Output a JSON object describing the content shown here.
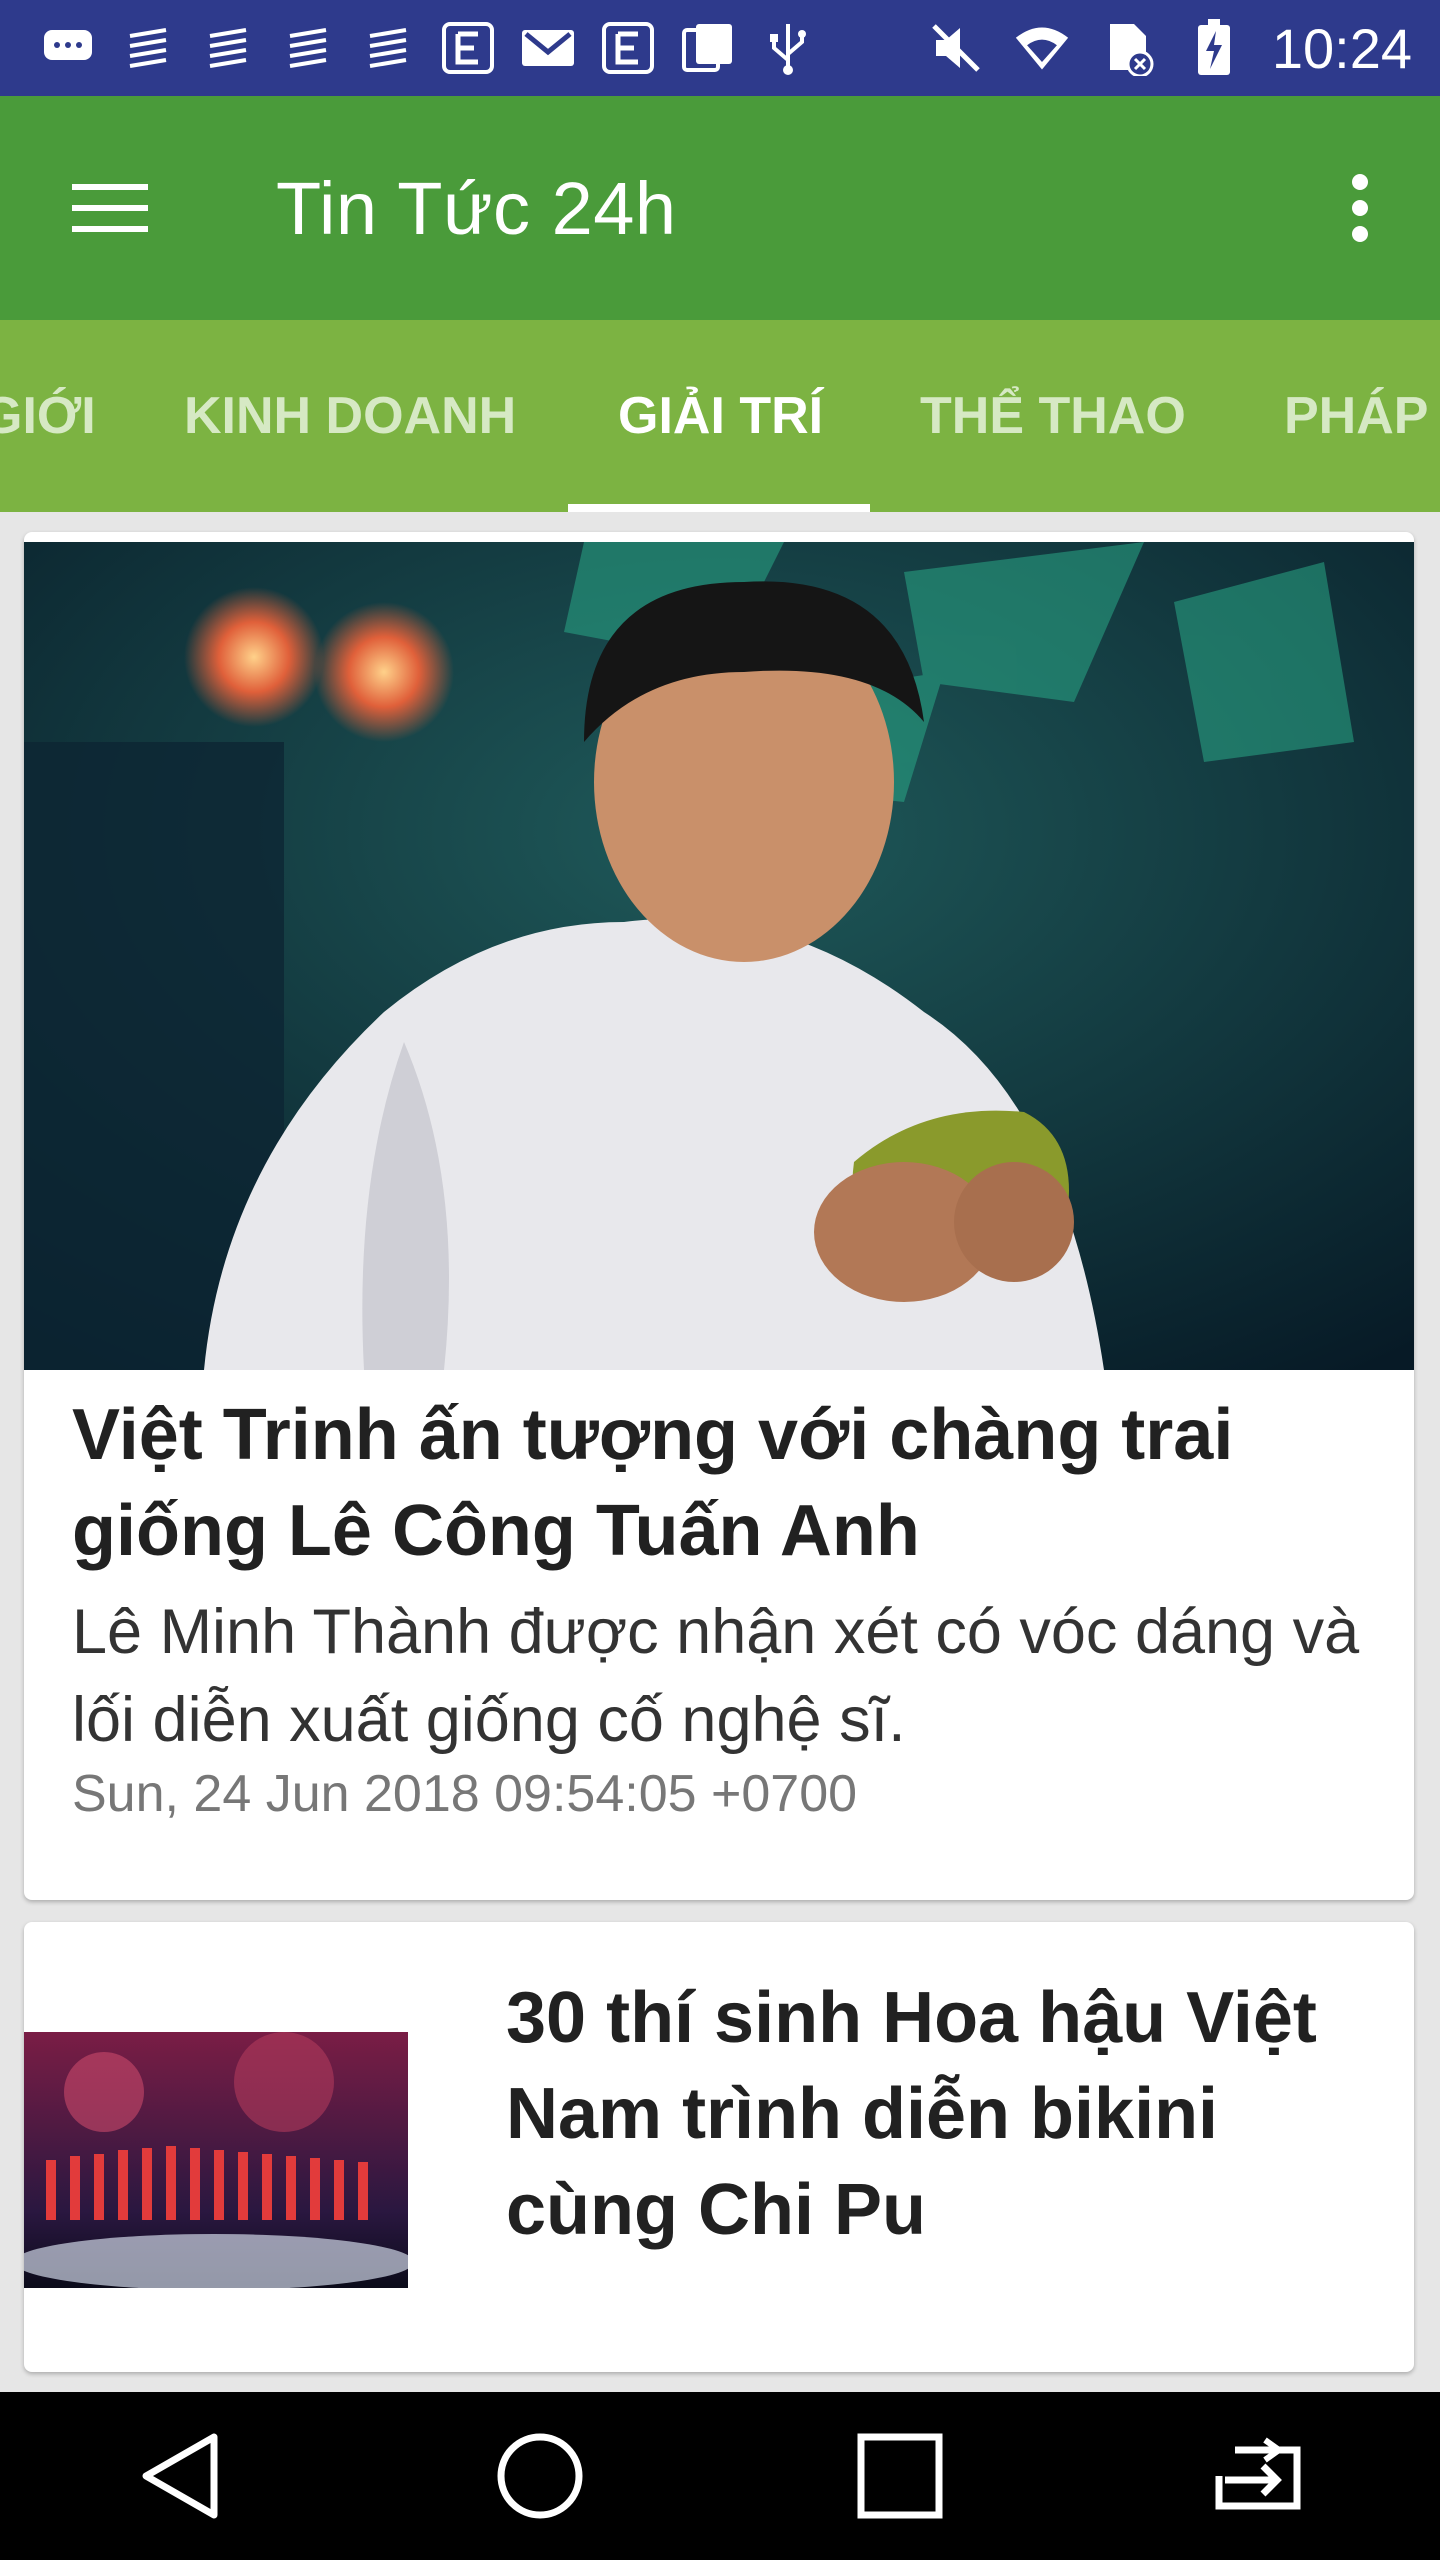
{
  "status_bar": {
    "time": "10:24",
    "left_icons": [
      "chat-icon",
      "notification-lines-icon",
      "notification-lines-icon",
      "notification-lines-icon",
      "notification-lines-icon",
      "email-e-icon",
      "gmail-icon",
      "email-e-icon",
      "copy-icon",
      "usb-icon"
    ],
    "right_icons": [
      "mute-icon",
      "wifi-icon",
      "sim-off-icon",
      "battery-charging-icon"
    ]
  },
  "appbar": {
    "title": "Tin Tức 24h"
  },
  "tabs": [
    {
      "label": "GIỚI"
    },
    {
      "label": "KINH DOANH"
    },
    {
      "label": "GIẢI TRÍ"
    },
    {
      "label": "THỂ THAO"
    },
    {
      "label": "PHÁP"
    }
  ],
  "active_tab": "GIẢI TRÍ",
  "articles": [
    {
      "headline": "Việt Trinh ấn tượng với chàng trai giống Lê Công Tuấn Anh",
      "summary": "Lê Minh Thành được nhận xét có vóc dáng và lối diễn xuất giống cố nghệ sĩ.",
      "date": "Sun, 24 Jun 2018 09:54:05 +0700"
    },
    {
      "headline": "30 thí sinh Hoa hậu Việt Nam trình diễn bikini cùng Chi Pu"
    }
  ],
  "colors": {
    "status_bar": "#2e3a8c",
    "app_bar": "#4a9b3a",
    "tab_bar": "#7cb342",
    "indicator": "#ffffff"
  }
}
